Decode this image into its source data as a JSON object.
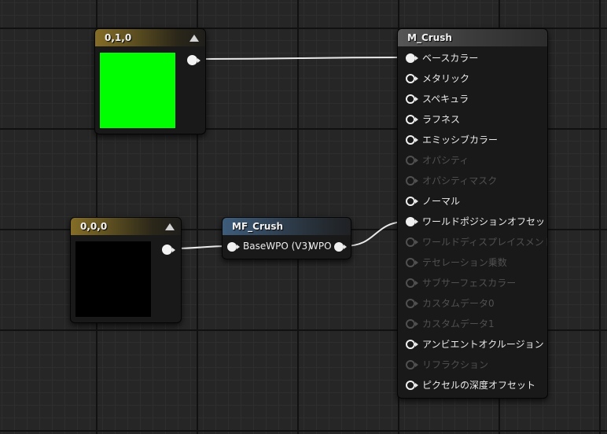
{
  "nodes": {
    "green_constant": {
      "title": "0,1,0",
      "color": "#00ff00"
    },
    "black_constant": {
      "title": "0,0,0",
      "color": "#000000"
    },
    "function_call": {
      "title": "MF_Crush",
      "input_label": "BaseWPO (V3)",
      "output_label": "WPO"
    },
    "material": {
      "title": "M_Crush",
      "inputs": [
        {
          "label": "ベースカラー",
          "connected": true,
          "enabled": true
        },
        {
          "label": "メタリック",
          "connected": false,
          "enabled": true
        },
        {
          "label": "スペキュラ",
          "connected": false,
          "enabled": true
        },
        {
          "label": "ラフネス",
          "connected": false,
          "enabled": true
        },
        {
          "label": "エミッシブカラー",
          "connected": false,
          "enabled": true
        },
        {
          "label": "オパシティ",
          "connected": false,
          "enabled": false
        },
        {
          "label": "オパシティマスク",
          "connected": false,
          "enabled": false
        },
        {
          "label": "ノーマル",
          "connected": false,
          "enabled": true
        },
        {
          "label": "ワールドポジションオフセット",
          "connected": true,
          "enabled": true
        },
        {
          "label": "ワールドディスプレイスメント",
          "connected": false,
          "enabled": false
        },
        {
          "label": "テセレーション乗数",
          "connected": false,
          "enabled": false
        },
        {
          "label": "サブサーフェスカラー",
          "connected": false,
          "enabled": false
        },
        {
          "label": "カスタムデータ0",
          "connected": false,
          "enabled": false
        },
        {
          "label": "カスタムデータ1",
          "connected": false,
          "enabled": false
        },
        {
          "label": "アンビエントオクルージョン",
          "connected": false,
          "enabled": true
        },
        {
          "label": "リフラクション",
          "connected": false,
          "enabled": false
        },
        {
          "label": "ピクセルの深度オフセット",
          "connected": false,
          "enabled": true
        }
      ]
    }
  },
  "icons": {
    "collapse": "collapse-triangle-icon",
    "pin": "pin-circle-icon"
  },
  "colors": {
    "canvas_bg": "#262626",
    "constant_header": "#846d27",
    "function_header": "#3d5d7c",
    "material_header": "#575757",
    "wire": "#eaeaea"
  }
}
